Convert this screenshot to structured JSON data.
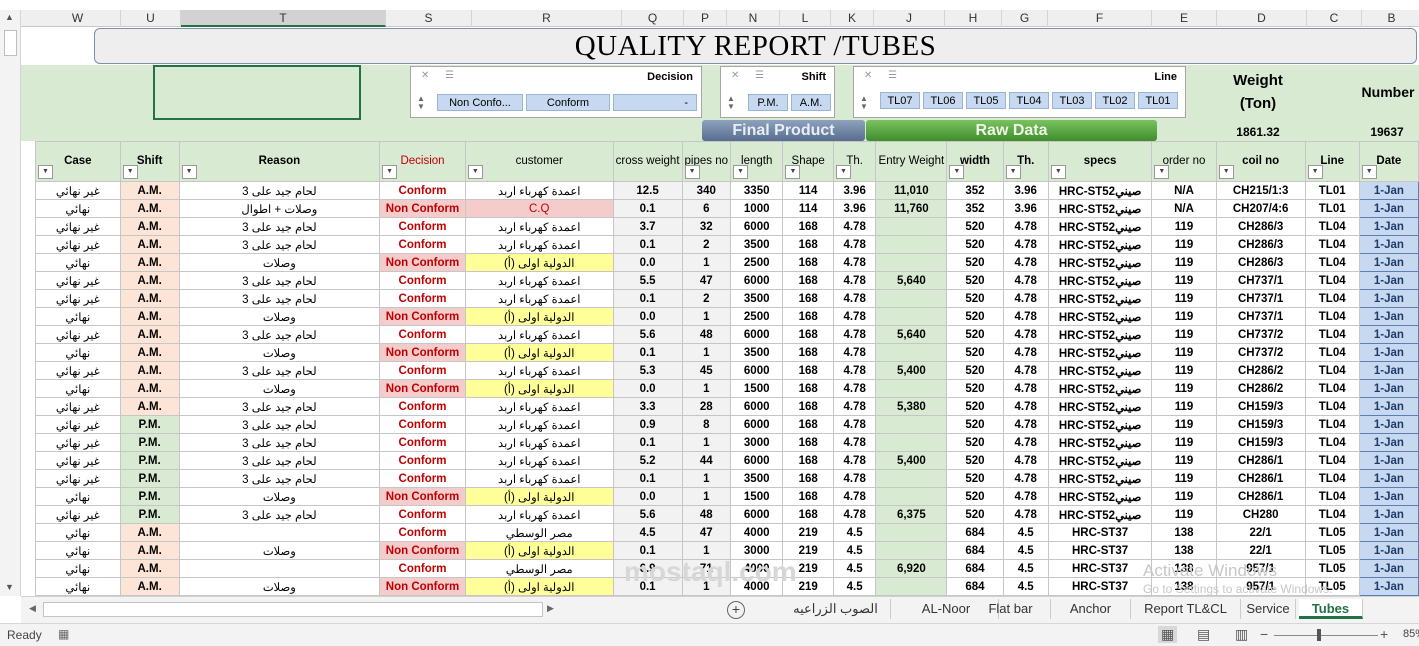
{
  "column_letters": [
    "W",
    "U",
    "T",
    "S",
    "R",
    "Q",
    "P",
    "N",
    "L",
    "K",
    "J",
    "H",
    "G",
    "F",
    "E",
    "D",
    "C",
    "B"
  ],
  "title": "QUALITY REPORT /TUBES",
  "slicers": {
    "decision": {
      "header": "Decision",
      "items": [
        "Non Confo...",
        "Conform",
        "-"
      ]
    },
    "shift": {
      "header": "Shift",
      "items": [
        "P.M.",
        "A.M."
      ]
    },
    "line": {
      "header": "Line",
      "items": [
        "TL07",
        "TL06",
        "TL05",
        "TL04",
        "TL03",
        "TL02",
        "TL01"
      ]
    }
  },
  "summary": {
    "weight_label1": "Weight",
    "weight_label2": "(Ton)",
    "weight_value": "1861.32",
    "number_label": "Number",
    "number_value": "19637"
  },
  "section_labels": {
    "final": "Final Product",
    "raw": "Raw Data"
  },
  "headers": [
    "Case",
    "Shift",
    "Reason",
    "Decision",
    "customer",
    "cross weight",
    "pipes no",
    "length",
    "Shape",
    "Th.",
    "Entry Weight",
    "width",
    "Th.",
    "specs",
    "order no",
    "coil no",
    "Line",
    "Date"
  ],
  "rows": [
    [
      "غير نهائي",
      "A.M.",
      "لحام جيد على 3",
      "Conform",
      "اعمدة كهرباء اربد",
      "12.5",
      "340",
      "3350",
      "114",
      "3.96",
      "11,010",
      "352",
      "3.96",
      "HRC-ST52صيني",
      "N/A",
      "CH215/1:3",
      "TL01",
      "1-Jan"
    ],
    [
      "نهائي",
      "A.M.",
      "وصلات + اطوال",
      "Non Conform",
      "C.Q",
      "0.1",
      "6",
      "1000",
      "114",
      "3.96",
      "11,760",
      "352",
      "3.96",
      "HRC-ST52صيني",
      "N/A",
      "CH207/4:6",
      "TL01",
      "1-Jan"
    ],
    [
      "غير نهائي",
      "A.M.",
      "لحام جيد على 3",
      "Conform",
      "اعمدة كهرباء اربد",
      "3.7",
      "32",
      "6000",
      "168",
      "4.78",
      "",
      "520",
      "4.78",
      "HRC-ST52صيني",
      "119",
      "CH286/3",
      "TL04",
      "1-Jan"
    ],
    [
      "غير نهائي",
      "A.M.",
      "لحام جيد على 3",
      "Conform",
      "اعمدة كهرباء اربد",
      "0.1",
      "2",
      "3500",
      "168",
      "4.78",
      "",
      "520",
      "4.78",
      "HRC-ST52صيني",
      "119",
      "CH286/3",
      "TL04",
      "1-Jan"
    ],
    [
      "نهائي",
      "A.M.",
      "وصلات",
      "Non Conform",
      "الدولية اولى (أ)",
      "0.0",
      "1",
      "2500",
      "168",
      "4.78",
      "",
      "520",
      "4.78",
      "HRC-ST52صيني",
      "119",
      "CH286/3",
      "TL04",
      "1-Jan"
    ],
    [
      "غير نهائي",
      "A.M.",
      "لحام جيد على 3",
      "Conform",
      "اعمدة كهرباء اربد",
      "5.5",
      "47",
      "6000",
      "168",
      "4.78",
      "5,640",
      "520",
      "4.78",
      "HRC-ST52صيني",
      "119",
      "CH737/1",
      "TL04",
      "1-Jan"
    ],
    [
      "غير نهائي",
      "A.M.",
      "لحام جيد على 3",
      "Conform",
      "اعمدة كهرباء اربد",
      "0.1",
      "2",
      "3500",
      "168",
      "4.78",
      "",
      "520",
      "4.78",
      "HRC-ST52صيني",
      "119",
      "CH737/1",
      "TL04",
      "1-Jan"
    ],
    [
      "نهائي",
      "A.M.",
      "وصلات",
      "Non Conform",
      "الدولية اولى (أ)",
      "0.0",
      "1",
      "2500",
      "168",
      "4.78",
      "",
      "520",
      "4.78",
      "HRC-ST52صيني",
      "119",
      "CH737/1",
      "TL04",
      "1-Jan"
    ],
    [
      "غير نهائي",
      "A.M.",
      "لحام جيد على 3",
      "Conform",
      "اعمدة كهرباء اربد",
      "5.6",
      "48",
      "6000",
      "168",
      "4.78",
      "5,640",
      "520",
      "4.78",
      "HRC-ST52صيني",
      "119",
      "CH737/2",
      "TL04",
      "1-Jan"
    ],
    [
      "نهائي",
      "A.M.",
      "وصلات",
      "Non Conform",
      "الدولية اولى (أ)",
      "0.1",
      "1",
      "3500",
      "168",
      "4.78",
      "",
      "520",
      "4.78",
      "HRC-ST52صيني",
      "119",
      "CH737/2",
      "TL04",
      "1-Jan"
    ],
    [
      "غير نهائي",
      "A.M.",
      "لحام جيد على 3",
      "Conform",
      "اعمدة كهرباء اربد",
      "5.3",
      "45",
      "6000",
      "168",
      "4.78",
      "5,400",
      "520",
      "4.78",
      "HRC-ST52صيني",
      "119",
      "CH286/2",
      "TL04",
      "1-Jan"
    ],
    [
      "نهائي",
      "A.M.",
      "وصلات",
      "Non Conform",
      "الدولية اولى (أ)",
      "0.0",
      "1",
      "1500",
      "168",
      "4.78",
      "",
      "520",
      "4.78",
      "HRC-ST52صيني",
      "119",
      "CH286/2",
      "TL04",
      "1-Jan"
    ],
    [
      "غير نهائي",
      "A.M.",
      "لحام جيد على 3",
      "Conform",
      "اعمدة كهرباء اربد",
      "3.3",
      "28",
      "6000",
      "168",
      "4.78",
      "5,380",
      "520",
      "4.78",
      "HRC-ST52صيني",
      "119",
      "CH159/3",
      "TL04",
      "1-Jan"
    ],
    [
      "غير نهائي",
      "P.M.",
      "لحام جيد على 3",
      "Conform",
      "اعمدة كهرباء اربد",
      "0.9",
      "8",
      "6000",
      "168",
      "4.78",
      "",
      "520",
      "4.78",
      "HRC-ST52صيني",
      "119",
      "CH159/3",
      "TL04",
      "1-Jan"
    ],
    [
      "غير نهائي",
      "P.M.",
      "لحام جيد على 3",
      "Conform",
      "اعمدة كهرباء اربد",
      "0.1",
      "1",
      "3000",
      "168",
      "4.78",
      "",
      "520",
      "4.78",
      "HRC-ST52صيني",
      "119",
      "CH159/3",
      "TL04",
      "1-Jan"
    ],
    [
      "غير نهائي",
      "P.M.",
      "لحام جيد على 3",
      "Conform",
      "اعمدة كهرباء اربد",
      "5.2",
      "44",
      "6000",
      "168",
      "4.78",
      "5,400",
      "520",
      "4.78",
      "HRC-ST52صيني",
      "119",
      "CH286/1",
      "TL04",
      "1-Jan"
    ],
    [
      "غير نهائي",
      "P.M.",
      "لحام جيد على 3",
      "Conform",
      "اعمدة كهرباء اربد",
      "0.1",
      "1",
      "3500",
      "168",
      "4.78",
      "",
      "520",
      "4.78",
      "HRC-ST52صيني",
      "119",
      "CH286/1",
      "TL04",
      "1-Jan"
    ],
    [
      "نهائي",
      "P.M.",
      "وصلات",
      "Non Conform",
      "الدولية اولى (أ)",
      "0.0",
      "1",
      "1500",
      "168",
      "4.78",
      "",
      "520",
      "4.78",
      "HRC-ST52صيني",
      "119",
      "CH286/1",
      "TL04",
      "1-Jan"
    ],
    [
      "غير نهائي",
      "P.M.",
      "لحام جيد على 3",
      "Conform",
      "اعمدة كهرباء اربد",
      "5.6",
      "48",
      "6000",
      "168",
      "4.78",
      "6,375",
      "520",
      "4.78",
      "HRC-ST52صيني",
      "119",
      "CH280",
      "TL04",
      "1-Jan"
    ],
    [
      "نهائي",
      "A.M.",
      "",
      "Conform",
      "مصر الوسطي",
      "4.5",
      "47",
      "4000",
      "219",
      "4.5",
      "",
      "684",
      "4.5",
      "HRC-ST37",
      "138",
      "22/1",
      "TL05",
      "1-Jan"
    ],
    [
      "نهائي",
      "A.M.",
      "وصلات",
      "Non Conform",
      "الدولية اولى (أ)",
      "0.1",
      "1",
      "3000",
      "219",
      "4.5",
      "",
      "684",
      "4.5",
      "HRC-ST37",
      "138",
      "22/1",
      "TL05",
      "1-Jan"
    ],
    [
      "نهائي",
      "A.M.",
      "",
      "Conform",
      "مصر الوسطي",
      "6.9",
      "71",
      "4000",
      "219",
      "4.5",
      "6,920",
      "684",
      "4.5",
      "HRC-ST37",
      "138",
      "957/1",
      "TL05",
      "1-Jan"
    ],
    [
      "نهائي",
      "A.M.",
      "وصلات",
      "Non Conform",
      "الدولية اولى (أ)",
      "0.1",
      "1",
      "4000",
      "219",
      "4.5",
      "",
      "684",
      "4.5",
      "HRC-ST37",
      "138",
      "957/1",
      "TL05",
      "1-Jan"
    ]
  ],
  "sheet_tabs": [
    "الصوب الزراعيه",
    "AL-Noor",
    "Flat bar",
    "Anchor",
    "Report TL&CL",
    "Service",
    "Tubes"
  ],
  "status": {
    "ready": "Ready",
    "zoom": "85%"
  },
  "watermark": {
    "line1": "Activate Windows",
    "line2": "Go to Settings to activate Windows.",
    "brand": "mostaql.com"
  }
}
